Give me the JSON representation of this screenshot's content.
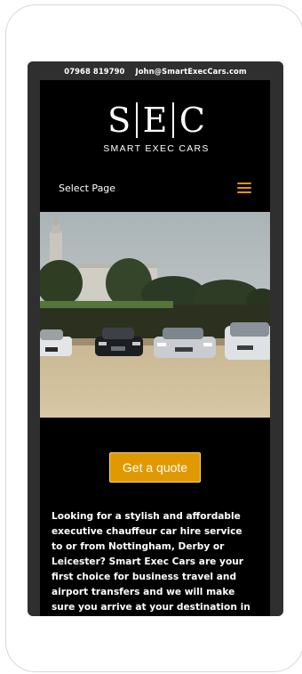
{
  "topbar": {
    "phone": "07968 819790",
    "email": "John@SmartExecCars.com"
  },
  "logo": {
    "letters": [
      "S",
      "E",
      "C"
    ],
    "subtitle": "SMART EXEC CARS"
  },
  "nav": {
    "label": "Select Page",
    "menu_icon": "hamburger-menu-icon",
    "accent": "#e09900"
  },
  "hero": {
    "description_icon": "hero-photo"
  },
  "cta": {
    "label": "Get a quote"
  },
  "intro": {
    "text": "Looking for a stylish and affordable executive chauffeur car hire service to or from Nottingham, Derby or Leicester? Smart Exec Cars are your first choice for business travel and airport transfers and we will make sure you arrive at your destination in comfort and style. Keep"
  }
}
